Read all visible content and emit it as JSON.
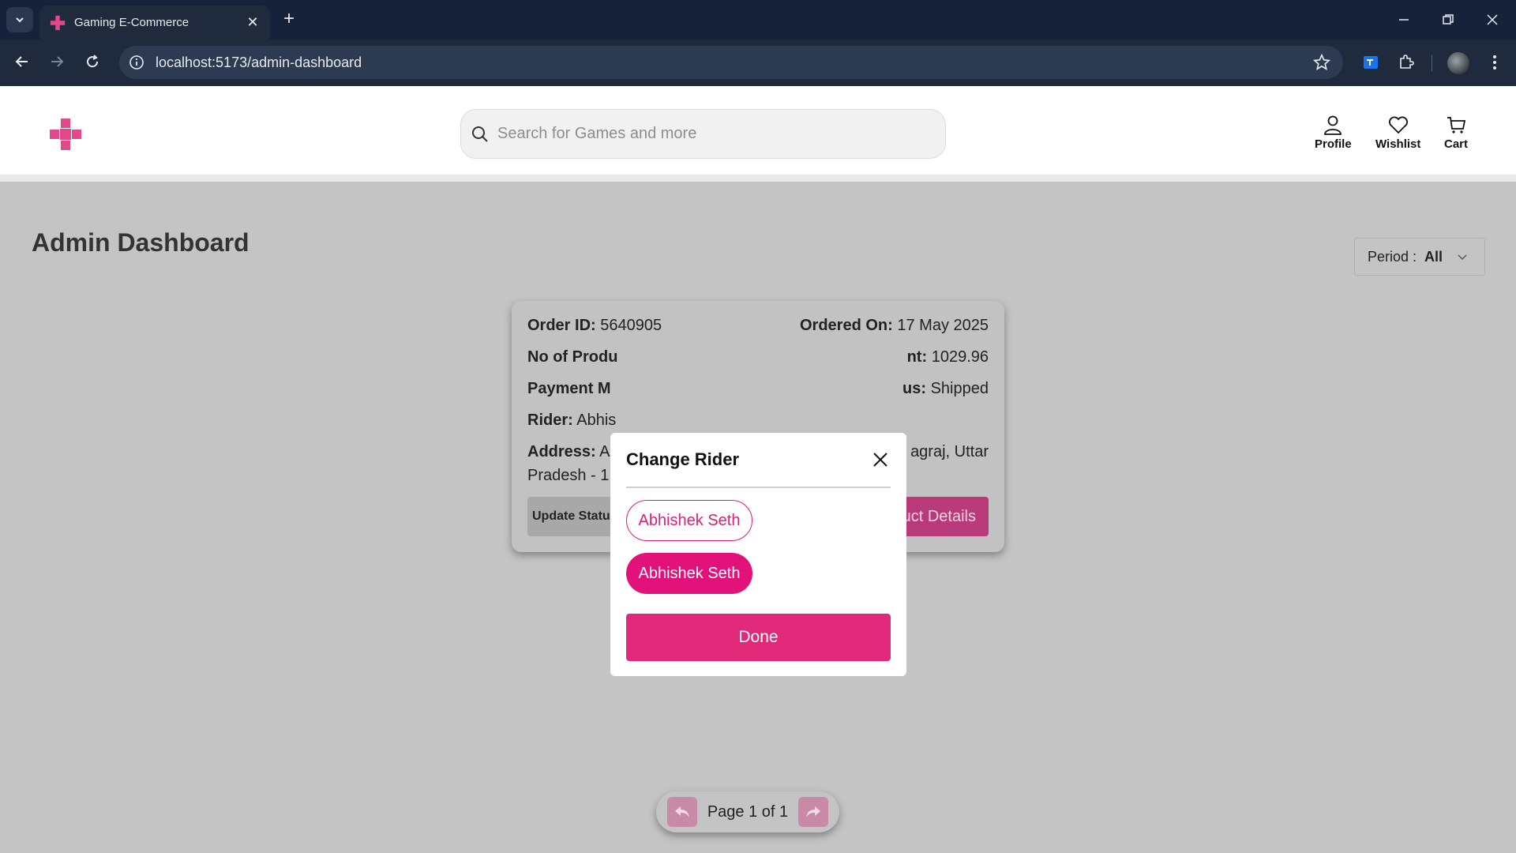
{
  "browser": {
    "tab_title": "Gaming E-Commerce",
    "url": "localhost:5173/admin-dashboard"
  },
  "header": {
    "search_placeholder": "Search for Games and more",
    "nav": {
      "profile": "Profile",
      "wishlist": "Wishlist",
      "cart": "Cart"
    }
  },
  "dashboard": {
    "title": "Admin Dashboard",
    "period_label": "Period :",
    "period_value": "All"
  },
  "order_card": {
    "order_id_label": "Order ID:",
    "order_id": "5640905",
    "ordered_on_label": "Ordered On:",
    "ordered_on": "17 May 2025",
    "products_label": "No of Produ",
    "amount_label": "nt:",
    "amount": "1029.96",
    "payment_label": "Payment M",
    "status_label": "us:",
    "status": "Shipped",
    "rider_label": "Rider:",
    "rider_value": "Abhis",
    "address_label": "Address:",
    "address_start": "A",
    "address_end": "agraj, Uttar",
    "address_line2": "Pradesh - 1",
    "update_button": "Update Statu",
    "details_button": "uct Details"
  },
  "pagination": {
    "text": "Page 1 of 1"
  },
  "modal": {
    "title": "Change Rider",
    "riders": [
      "Abhishek Seth",
      "Abhishek Seth"
    ],
    "done_label": "Done"
  },
  "colors": {
    "brand_pink": "#e02a79",
    "overlay_gray": "#c4c4c4",
    "chrome_dark": "#1f2a3d"
  },
  "icons": {
    "logo": "gamepad-cross-icon",
    "search": "search-icon",
    "profile": "user-icon",
    "wishlist": "heart-icon",
    "cart": "cart-icon",
    "close": "close-icon"
  }
}
